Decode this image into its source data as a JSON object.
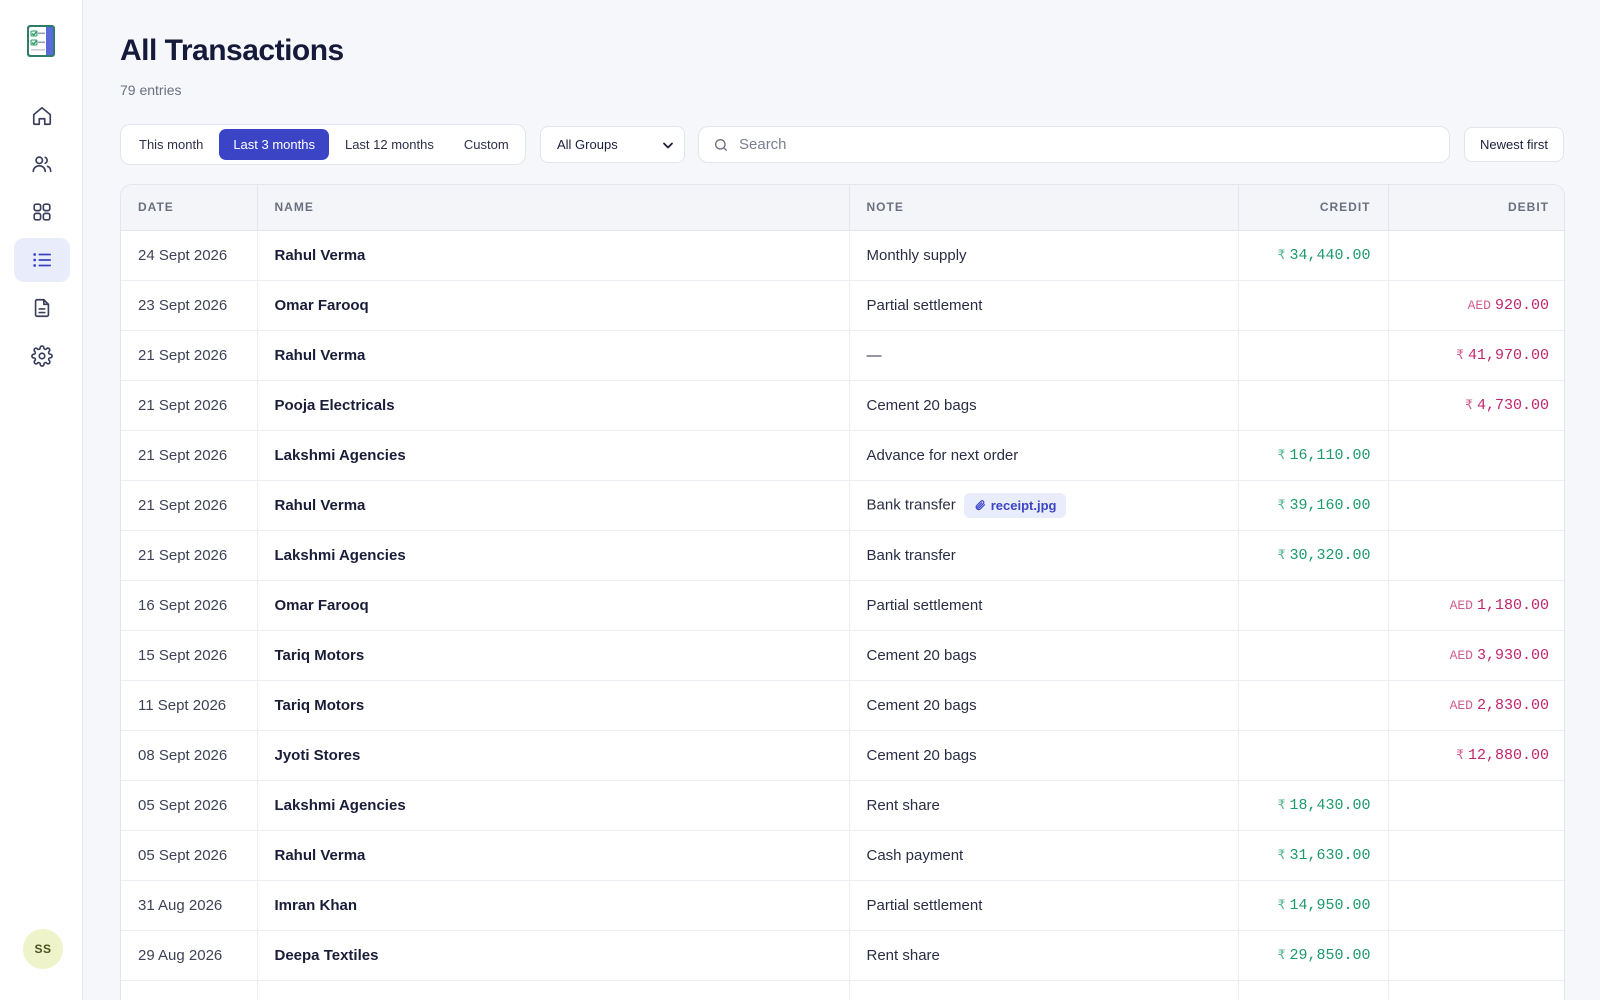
{
  "page": {
    "title": "All Transactions",
    "count": "79 entries"
  },
  "sidebar": {
    "avatar_initials": "SS",
    "items": [
      {
        "name": "home",
        "icon": "home-icon"
      },
      {
        "name": "people",
        "icon": "users-icon"
      },
      {
        "name": "groups",
        "icon": "grid-icon"
      },
      {
        "name": "transactions",
        "icon": "list-icon",
        "active": true
      },
      {
        "name": "reports",
        "icon": "document-icon"
      },
      {
        "name": "settings",
        "icon": "gear-icon"
      }
    ]
  },
  "filters": {
    "ranges": [
      "This month",
      "Last 3 months",
      "Last 12 months",
      "Custom"
    ],
    "active_range": "Last 3 months",
    "group_select": "All Groups",
    "search_placeholder": "Search",
    "sort": "Newest first"
  },
  "table": {
    "headers": {
      "date": "DATE",
      "name": "NAME",
      "note": "NOTE",
      "credit": "CREDIT",
      "debit": "DEBIT"
    },
    "rows": [
      {
        "date": "24 Sept 2026",
        "name": "Rahul Verma",
        "note": "Monthly supply",
        "credit_cur": "₹",
        "credit": "34,440.00",
        "debit_cur": "",
        "debit": ""
      },
      {
        "date": "23 Sept 2026",
        "name": "Omar Farooq",
        "note": "Partial settlement",
        "credit_cur": "",
        "credit": "",
        "debit_cur": "AED",
        "debit": "920.00"
      },
      {
        "date": "21 Sept 2026",
        "name": "Rahul Verma",
        "note": "—",
        "credit_cur": "",
        "credit": "",
        "debit_cur": "₹",
        "debit": "41,970.00"
      },
      {
        "date": "21 Sept 2026",
        "name": "Pooja Electricals",
        "note": "Cement 20 bags",
        "credit_cur": "",
        "credit": "",
        "debit_cur": "₹",
        "debit": "4,730.00"
      },
      {
        "date": "21 Sept 2026",
        "name": "Lakshmi Agencies",
        "note": "Advance for next order",
        "credit_cur": "₹",
        "credit": "16,110.00",
        "debit_cur": "",
        "debit": ""
      },
      {
        "date": "21 Sept 2026",
        "name": "Rahul Verma",
        "note": "Bank transfer",
        "attachment": "receipt.jpg",
        "credit_cur": "₹",
        "credit": "39,160.00",
        "debit_cur": "",
        "debit": ""
      },
      {
        "date": "21 Sept 2026",
        "name": "Lakshmi Agencies",
        "note": "Bank transfer",
        "credit_cur": "₹",
        "credit": "30,320.00",
        "debit_cur": "",
        "debit": ""
      },
      {
        "date": "16 Sept 2026",
        "name": "Omar Farooq",
        "note": "Partial settlement",
        "credit_cur": "",
        "credit": "",
        "debit_cur": "AED",
        "debit": "1,180.00"
      },
      {
        "date": "15 Sept 2026",
        "name": "Tariq Motors",
        "note": "Cement 20 bags",
        "credit_cur": "",
        "credit": "",
        "debit_cur": "AED",
        "debit": "3,930.00"
      },
      {
        "date": "11 Sept 2026",
        "name": "Tariq Motors",
        "note": "Cement 20 bags",
        "credit_cur": "",
        "credit": "",
        "debit_cur": "AED",
        "debit": "2,830.00"
      },
      {
        "date": "08 Sept 2026",
        "name": "Jyoti Stores",
        "note": "Cement 20 bags",
        "credit_cur": "",
        "credit": "",
        "debit_cur": "₹",
        "debit": "12,880.00"
      },
      {
        "date": "05 Sept 2026",
        "name": "Lakshmi Agencies",
        "note": "Rent share",
        "credit_cur": "₹",
        "credit": "18,430.00",
        "debit_cur": "",
        "debit": ""
      },
      {
        "date": "05 Sept 2026",
        "name": "Rahul Verma",
        "note": "Cash payment",
        "credit_cur": "₹",
        "credit": "31,630.00",
        "debit_cur": "",
        "debit": ""
      },
      {
        "date": "31 Aug 2026",
        "name": "Imran Khan",
        "note": "Partial settlement",
        "credit_cur": "₹",
        "credit": "14,950.00",
        "debit_cur": "",
        "debit": ""
      },
      {
        "date": "29 Aug 2026",
        "name": "Deepa Textiles",
        "note": "Rent share",
        "credit_cur": "₹",
        "credit": "29,850.00",
        "debit_cur": "",
        "debit": ""
      }
    ]
  },
  "colors": {
    "accent": "#3c44c6",
    "credit": "#1c9a6a",
    "debit": "#c0266d"
  }
}
